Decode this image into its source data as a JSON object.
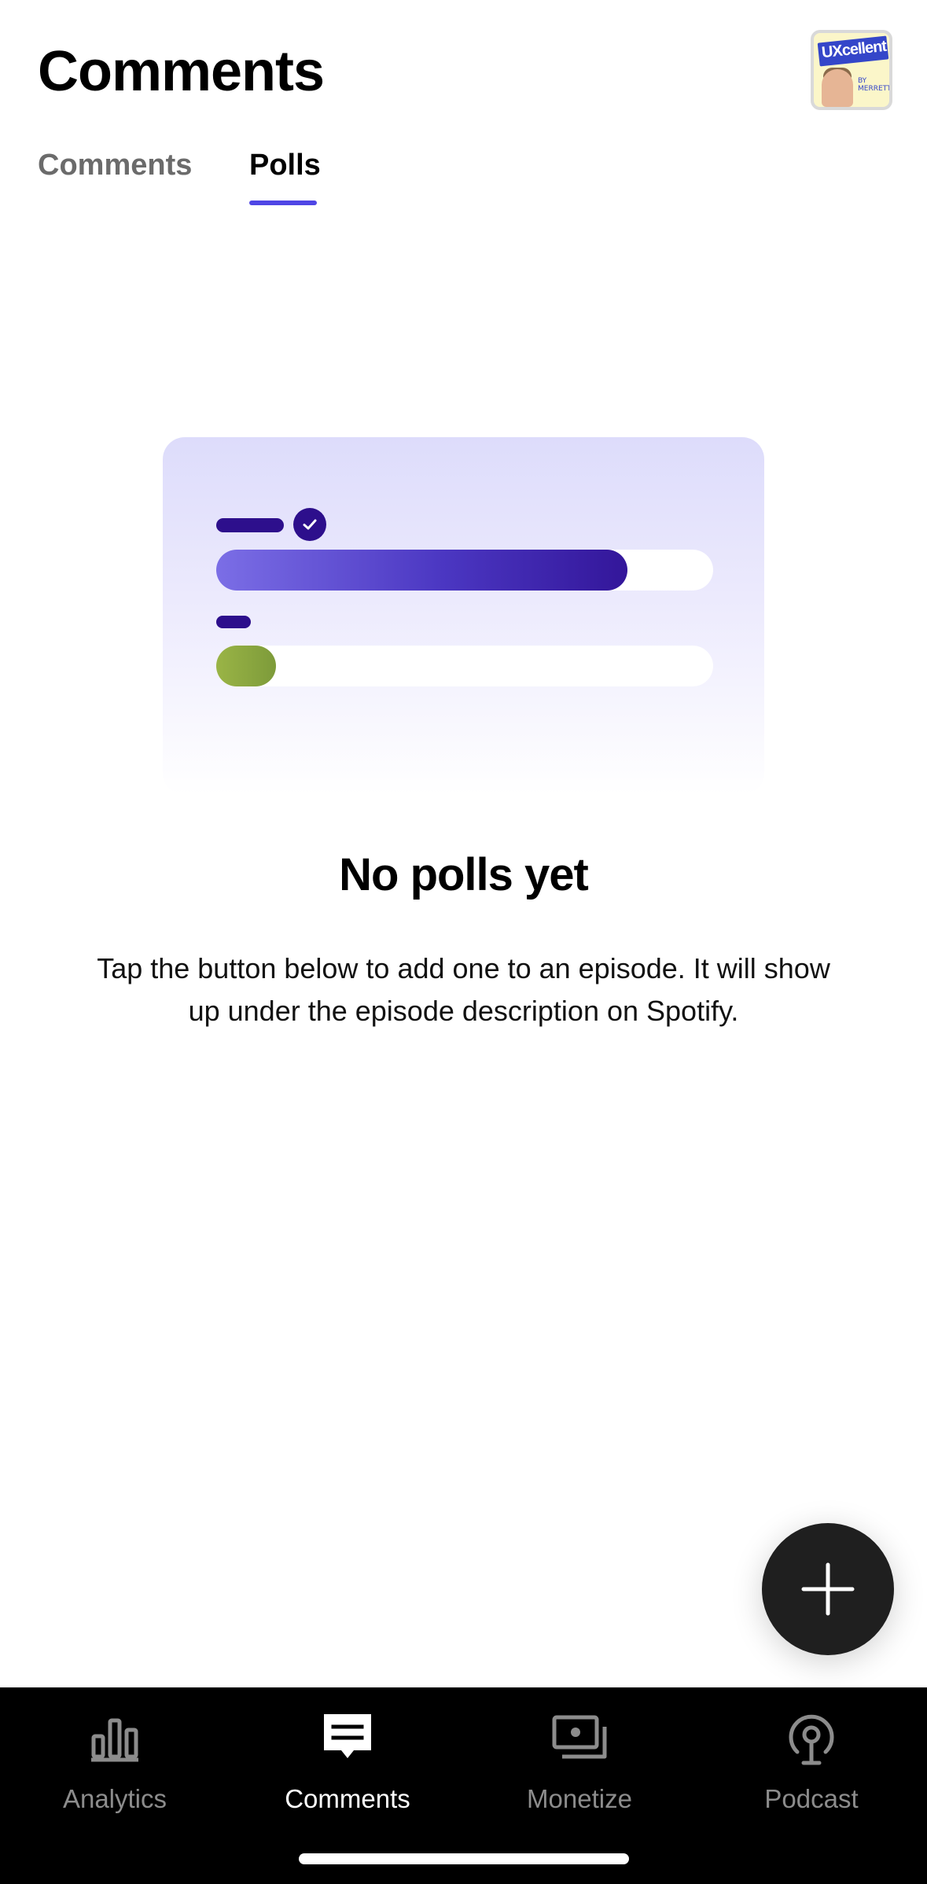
{
  "header": {
    "title": "Comments",
    "avatar_alt": "UXcellent podcast cover"
  },
  "tabs": [
    {
      "label": "Comments",
      "active": false
    },
    {
      "label": "Polls",
      "active": true
    }
  ],
  "empty_state": {
    "title": "No polls yet",
    "description": "Tap the button below to add one to an episode. It will show up under the episode description on Spotify."
  },
  "fab": {
    "icon": "plus-icon"
  },
  "bottom_nav": {
    "items": [
      {
        "label": "Analytics",
        "icon": "analytics-icon",
        "active": false
      },
      {
        "label": "Comments",
        "icon": "comments-icon",
        "active": true
      },
      {
        "label": "Monetize",
        "icon": "monetize-icon",
        "active": false
      },
      {
        "label": "Podcast",
        "icon": "podcast-icon",
        "active": false
      }
    ]
  },
  "colors": {
    "accent": "#4f46e5",
    "poll_purple": "#2d0f8c",
    "poll_green": "#8aa63e",
    "nav_background": "#000000",
    "fab_background": "#1f1f1f"
  }
}
